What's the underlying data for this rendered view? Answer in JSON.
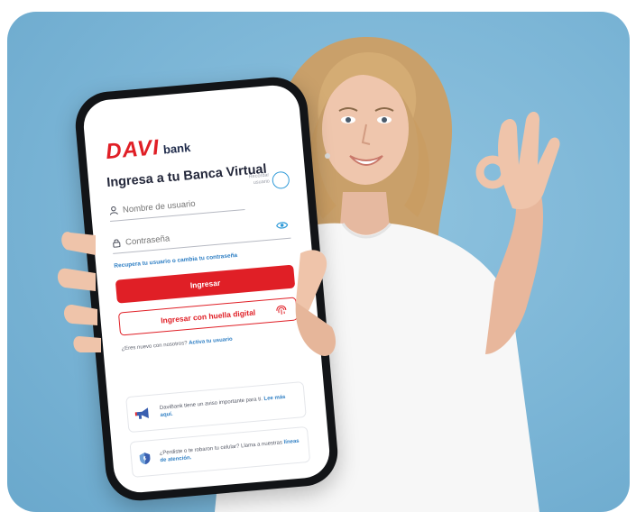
{
  "brand": {
    "logo_word": "DAVI",
    "logo_sub": "bank",
    "brand_color": "#e01f26"
  },
  "login": {
    "title": "Ingresa a tu Banca Virtual",
    "username_placeholder": "Nombre de usuario",
    "remember_label": "Recordar usuario",
    "password_placeholder": "Contraseña",
    "recover_link": "Recupera tu usuario o cambia tu contraseña",
    "submit_label": "Ingresar",
    "fingerprint_label": "Ingresar con huella digital",
    "signup_text": "¿Eres nuevo con nosotros?",
    "signup_link": "Activa tu usuario"
  },
  "cards": [
    {
      "icon": "megaphone-icon",
      "text": "DaviBank tiene un aviso importante para ti.",
      "link": "Lee más aquí."
    },
    {
      "icon": "shield-icon",
      "text": "¿Perdiste o te robaron tu celular? Llama a nuestras",
      "link": "líneas de atención."
    }
  ]
}
